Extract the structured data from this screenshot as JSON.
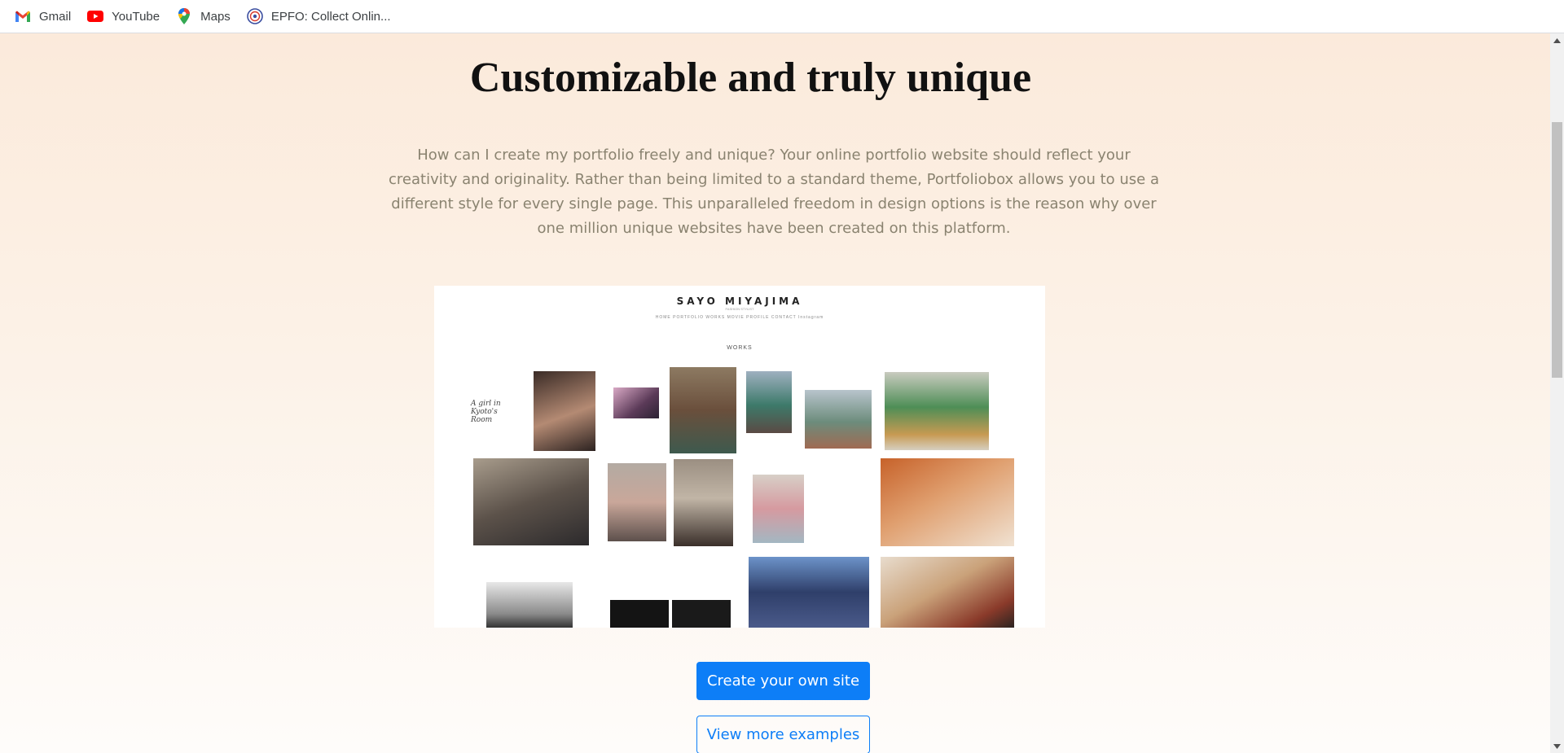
{
  "bookmarks": [
    {
      "label": "Gmail",
      "icon": "gmail-icon"
    },
    {
      "label": "YouTube",
      "icon": "youtube-icon"
    },
    {
      "label": "Maps",
      "icon": "maps-icon"
    },
    {
      "label": "EPFO: Collect Onlin...",
      "icon": "epfo-icon"
    }
  ],
  "section": {
    "headline": "Customizable and truly unique",
    "description": "How can I create my portfolio freely and unique? Your online portfolio website should reflect your creativity and originality. Rather than being limited to a standard theme, Portfoliobox allows you to use a different style for every single page. This unparalleled freedom in design options is the reason why over one million unique websites have been created on this platform."
  },
  "example_site": {
    "name": "SAYO MIYAJIMA",
    "subtitle": "FASHION STYLIST",
    "nav": "HOME   PORTFOLIO   WORKS   MOVIE   PROFILE   CONTACT   Instagram",
    "section_label": "WORKS",
    "script_text": "A girl in Kyoto's Room"
  },
  "buttons": {
    "primary": "Create your own site",
    "secondary": "View more examples"
  },
  "colors": {
    "accent": "#0d7ef7",
    "background_top": "#fbeadb",
    "description_text": "#8a8370"
  }
}
